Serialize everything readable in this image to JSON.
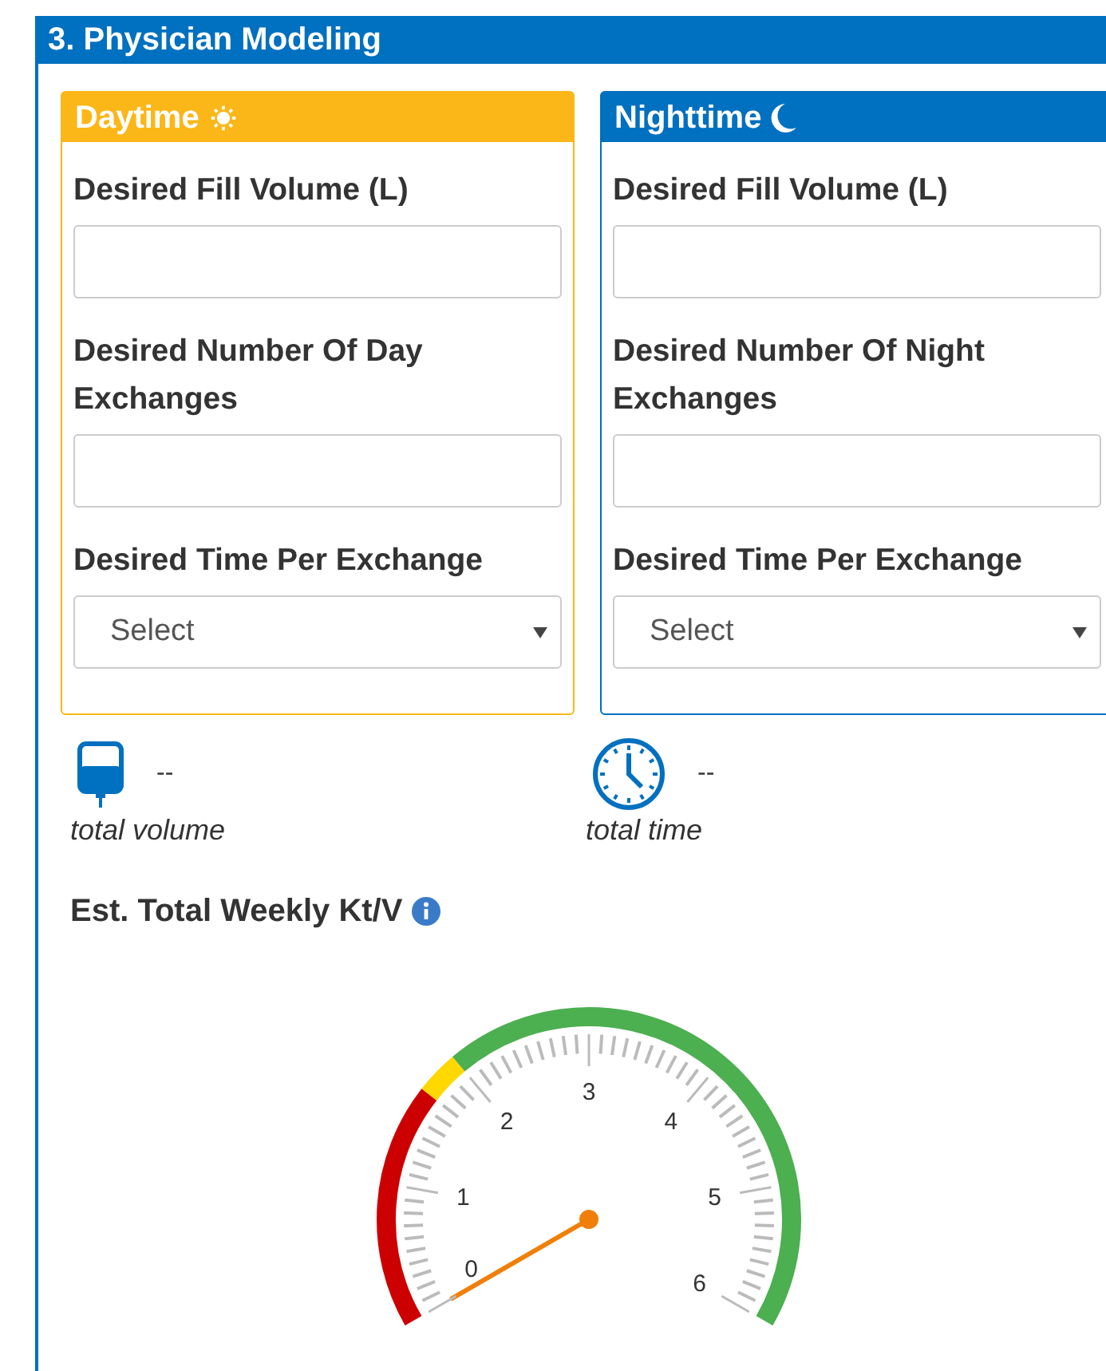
{
  "panel": {
    "title": "3. Physician Modeling"
  },
  "cards": [
    {
      "kind": "day",
      "title": "Daytime",
      "fields": [
        {
          "kind": "text",
          "label": "Desired Fill Volume (L)"
        },
        {
          "kind": "text",
          "label": "Desired Number Of Day Exchanges"
        },
        {
          "kind": "select",
          "label": "Desired Time Per Exchange",
          "value": "Select"
        }
      ]
    },
    {
      "kind": "night",
      "title": "Nighttime",
      "fields": [
        {
          "kind": "text",
          "label": "Desired Fill Volume (L)"
        },
        {
          "kind": "text",
          "label": "Desired Number Of Night Exchanges"
        },
        {
          "kind": "select",
          "label": "Desired Time Per Exchange",
          "value": "Select"
        }
      ]
    }
  ],
  "totals": [
    {
      "kind": "volume",
      "value": "--",
      "caption": "total volume"
    },
    {
      "kind": "time",
      "value": "--",
      "caption": "total time"
    }
  ],
  "gauge": {
    "title": "Est. Total Weekly Kt/V",
    "tick_labels": [
      "0",
      "1",
      "2",
      "3",
      "4",
      "5",
      "6"
    ],
    "bands": [
      {
        "color": "#cc0000"
      },
      {
        "color": "#ffd800"
      },
      {
        "color": "#4caf50"
      }
    ]
  }
}
